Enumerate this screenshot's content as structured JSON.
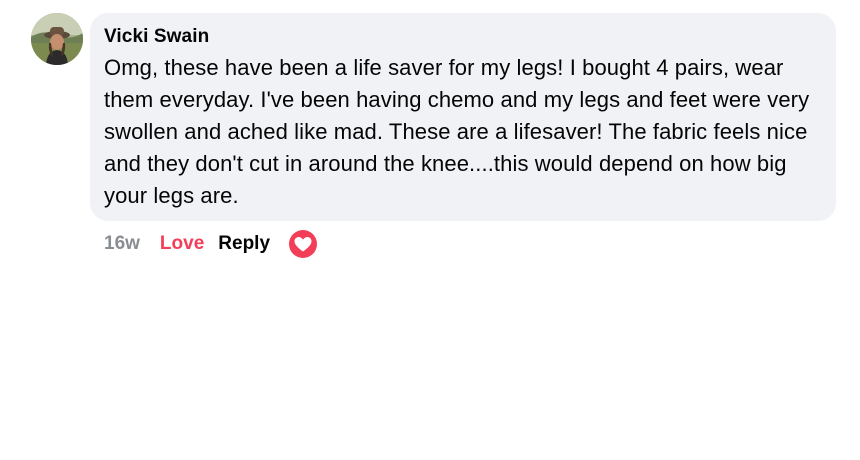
{
  "comment": {
    "author": "Vicki Swain",
    "text": "Omg, these have been a life saver for my legs! I bought 4 pairs, wear them everyday. I've been having chemo and my legs and feet were very swollen and ached like mad. These are a lifesaver! The fabric feels nice and they don't cut in around the knee....this would depend on how big your legs are.",
    "time": "16w",
    "reaction_label": "Love",
    "reply_label": "Reply",
    "reaction_icon": "heart-icon",
    "reaction_color": "#f33e58"
  }
}
